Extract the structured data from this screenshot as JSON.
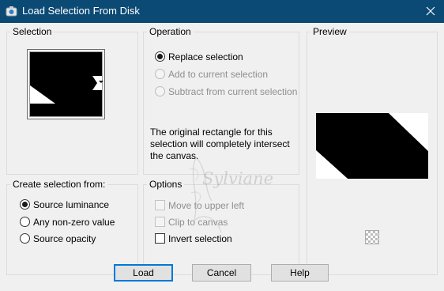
{
  "window": {
    "title": "Load Selection From Disk",
    "app_icon": "paint-app-icon",
    "close_icon": "close-icon"
  },
  "selection": {
    "label": "Selection",
    "dropdown_icon": "dropdown-arrow-icon"
  },
  "operation": {
    "label": "Operation",
    "options": [
      "Replace selection",
      "Add to current selection",
      "Subtract from current selection"
    ],
    "selected": "Replace selection",
    "note": "The original rectangle for this selection will completely intersect the canvas."
  },
  "preview": {
    "label": "Preview",
    "background_icon": "checkerboard-icon"
  },
  "create_from": {
    "label": "Create selection from:",
    "options": [
      "Source luminance",
      "Any non-zero value",
      "Source opacity"
    ],
    "selected": "Source luminance"
  },
  "options": {
    "label": "Options",
    "move_upper_left": "Move to upper left",
    "clip_canvas": "Clip to canvas",
    "invert": "Invert selection",
    "invert_checked": false
  },
  "watermark": {
    "text": "Sylviane"
  },
  "buttons": {
    "load": "Load",
    "cancel": "Cancel",
    "help": "Help"
  },
  "colors": {
    "titlebar": "#0b4a75",
    "dialog_bg": "#f0f0f0",
    "default_button_border": "#0078d7"
  }
}
